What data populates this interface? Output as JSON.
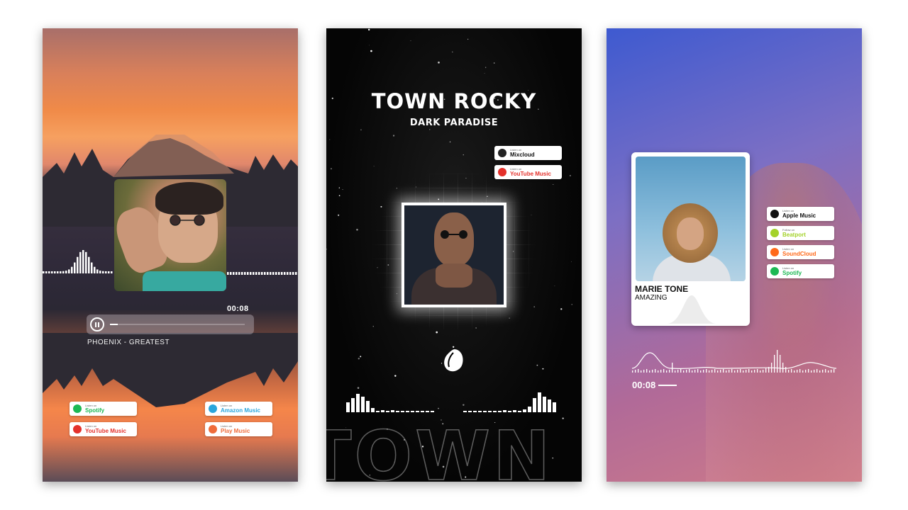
{
  "cards": [
    {
      "theme": "sunset-lake",
      "player": {
        "time": "00:08",
        "progress": 0.06,
        "track": "PHOENIX - GREATEST"
      },
      "badges": [
        {
          "small": "Listen on",
          "name": "Spotify",
          "color": "#1db954",
          "icon": "spotify-icon"
        },
        {
          "small": "Listen on",
          "name": "Amazon Music",
          "color": "#2aa6dc",
          "icon": "amazon-music-icon"
        },
        {
          "small": "Listen on",
          "name": "YouTube Music",
          "color": "#e4312b",
          "icon": "youtube-music-icon"
        },
        {
          "small": "Listen on",
          "name": "Play Music",
          "color": "#ef6c3a",
          "icon": "play-music-icon"
        }
      ]
    },
    {
      "theme": "dark-space",
      "title": "TOWN ROCKY",
      "subtitle": "DARK PARADISE",
      "watermark": "TOWN ROCKY",
      "badges": [
        {
          "small": "Listen on",
          "name": "Mixcloud",
          "color": "#222222",
          "icon": "mixcloud-icon"
        },
        {
          "small": "Listen on",
          "name": "YouTube Music",
          "color": "#e4312b",
          "icon": "youtube-music-icon"
        }
      ]
    },
    {
      "theme": "purple-gradient",
      "artist": "MARIE TONE",
      "song": "AMAZING",
      "time": "00:08",
      "badges": [
        {
          "small": "Listen on",
          "name": "Apple Music",
          "color": "#111111",
          "icon": "apple-music-icon"
        },
        {
          "small": "Follow on",
          "name": "Beatport",
          "color": "#a4d22a",
          "icon": "beatport-icon"
        },
        {
          "small": "Listen on",
          "name": "SoundCloud",
          "color": "#ff6a1a",
          "icon": "soundcloud-icon"
        },
        {
          "small": "Listen on",
          "name": "Spotify",
          "color": "#1db954",
          "icon": "spotify-icon"
        }
      ]
    }
  ]
}
